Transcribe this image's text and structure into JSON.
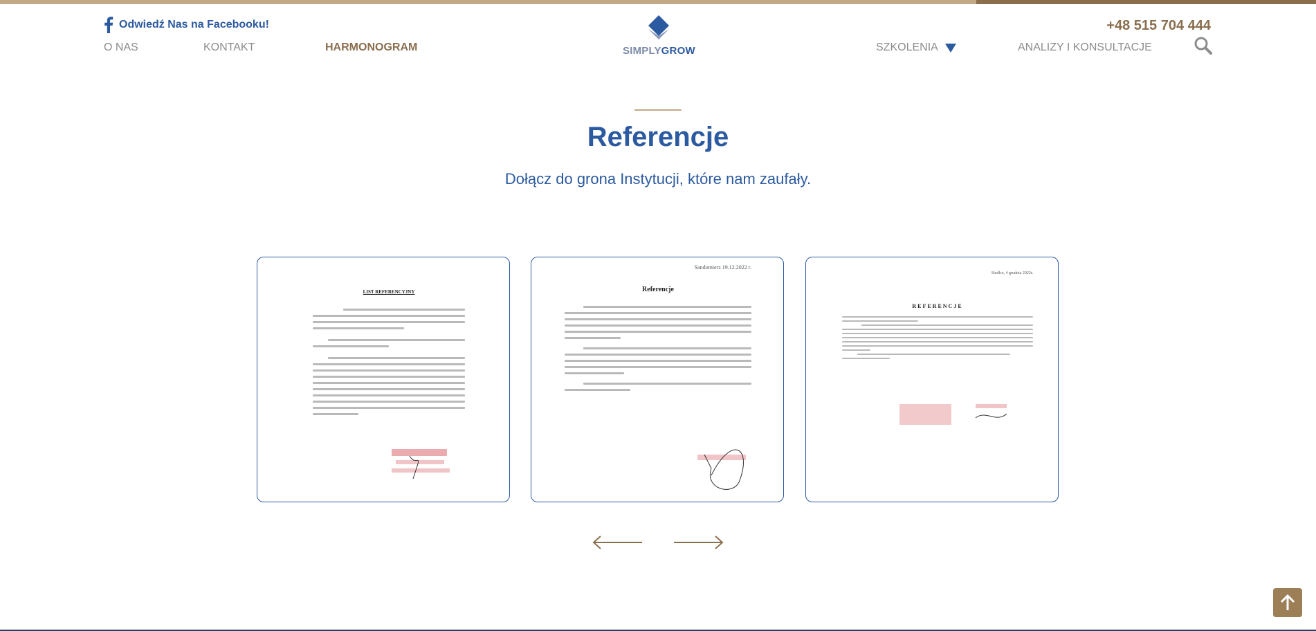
{
  "header": {
    "facebook_label": "Odwiedź Nas na Facebooku!",
    "phone": "+48 515 704 444",
    "nav_left": [
      "O NAS",
      "KONTAKT",
      "HARMONOGRAM"
    ],
    "nav_right": [
      "SZKOLENIA",
      "ANALIZY I KONSULTACJE"
    ],
    "active_item": "HARMONOGRAM",
    "logo": {
      "part1": "SIMPLY",
      "part2": "GROW"
    }
  },
  "section": {
    "title": "Referencje",
    "subtitle": "Dołącz do grona Instytucji, które nam zaufały."
  },
  "references": [
    {
      "heading": "LIST REFERENCYJNY",
      "date": ""
    },
    {
      "heading": "Referencje",
      "date": "Sandomierz 19.12.2022 r."
    },
    {
      "heading": "REFERENCJE",
      "date": "Siedlce, 4 grudnia 2022r."
    }
  ],
  "colors": {
    "brand_blue": "#2c5aa0",
    "brand_gold": "#8a6e4e",
    "accent_tan": "#c2a987"
  }
}
